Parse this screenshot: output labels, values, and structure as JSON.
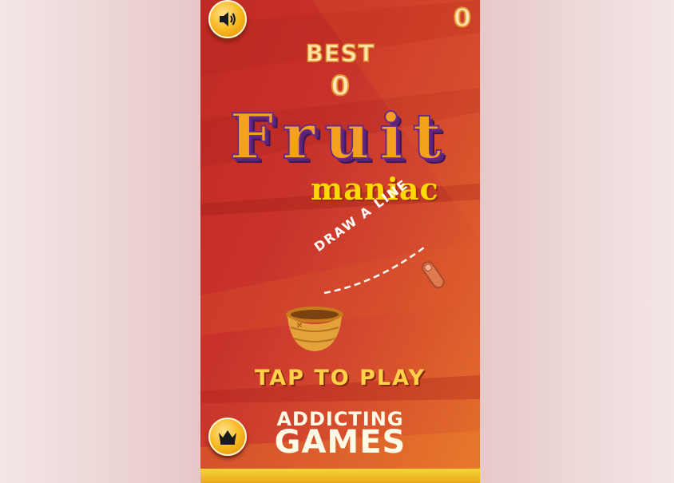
{
  "score": {
    "current": "0"
  },
  "best": {
    "label": "BEST",
    "value": "0"
  },
  "title": {
    "main": "Fruit",
    "sub": "maniac"
  },
  "hint": {
    "text": "DRAW A LINE"
  },
  "cta": {
    "label": "TAP TO PLAY"
  },
  "brand": {
    "line1": "ADDICTING",
    "line2": "GAMES"
  },
  "buttons": {
    "sound_icon": "speaker-icon",
    "leaderboard_icon": "crown-icon"
  },
  "colors": {
    "accent": "#f7b51a",
    "background": "#c8322a",
    "title_fill": "#f4a21e",
    "title_outline": "#6b2a88"
  }
}
